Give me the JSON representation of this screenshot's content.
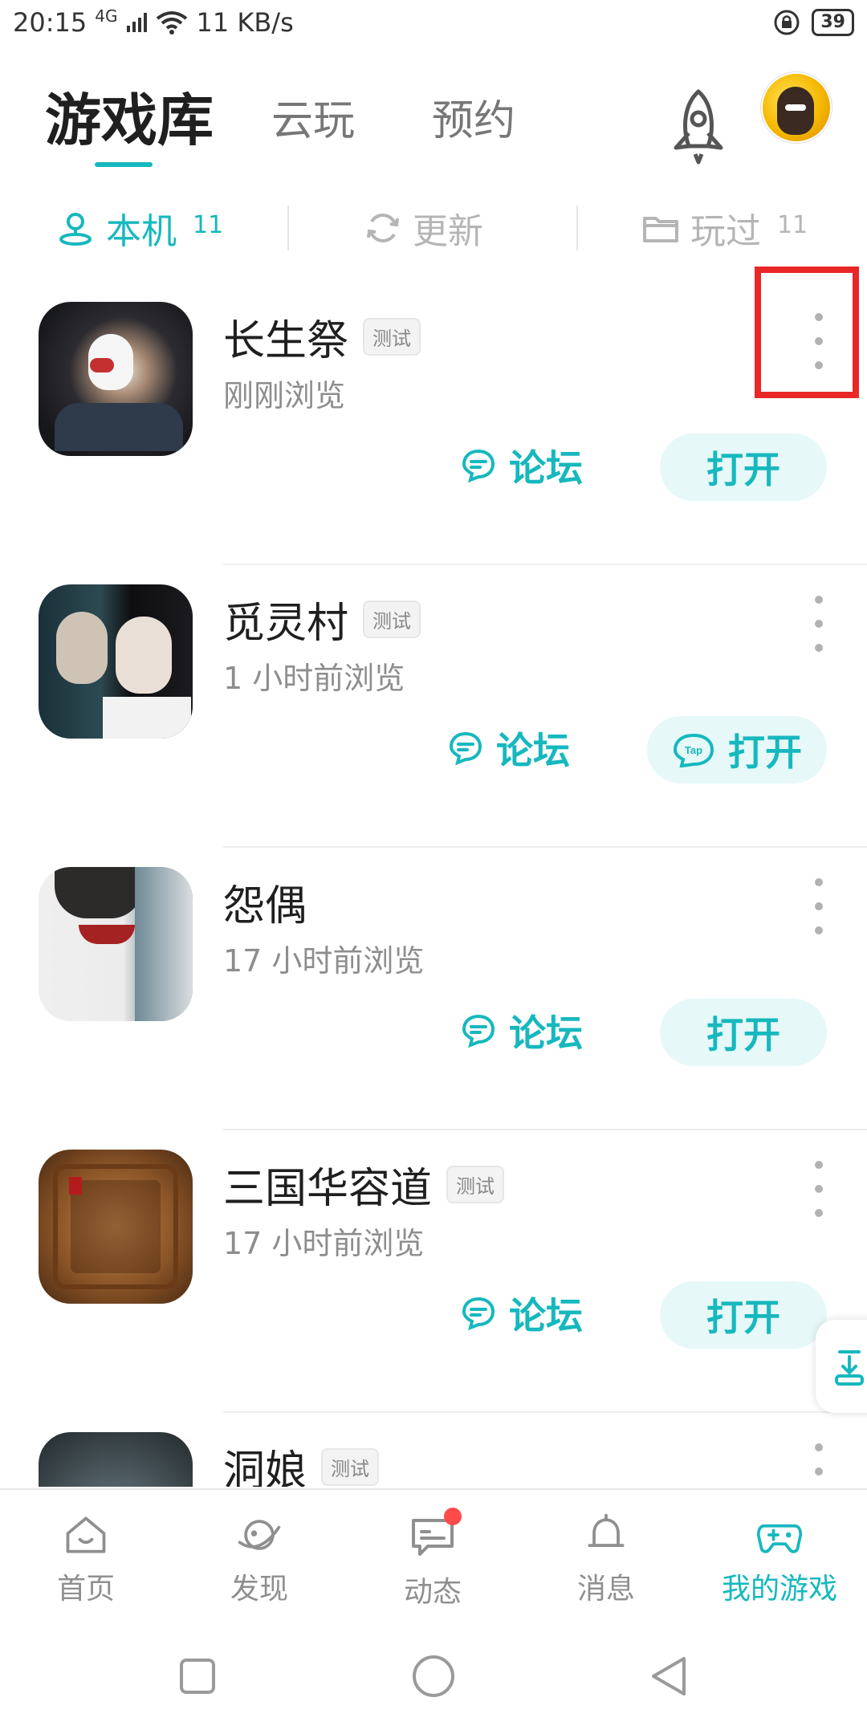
{
  "status_bar": {
    "time": "20:15",
    "network": "4G",
    "speed": "11 KB/s",
    "battery": "39"
  },
  "header": {
    "tabs": [
      {
        "label": "游戏库",
        "active": true
      },
      {
        "label": "云玩",
        "active": false
      },
      {
        "label": "预约",
        "active": false
      }
    ]
  },
  "subtabs": [
    {
      "label": "本机",
      "count": "11",
      "icon": "user-location-icon",
      "active": true
    },
    {
      "label": "更新",
      "count": "",
      "icon": "refresh-icon",
      "active": false
    },
    {
      "label": "玩过",
      "count": "11",
      "icon": "folder-icon",
      "active": false
    }
  ],
  "games": [
    {
      "title": "长生祭",
      "badge": "测试",
      "subtitle": "刚刚浏览",
      "forum": "论坛",
      "open": "打开",
      "open_has_tap_icon": false
    },
    {
      "title": "觅灵村",
      "badge": "测试",
      "subtitle": "1 小时前浏览",
      "forum": "论坛",
      "open": "打开",
      "open_has_tap_icon": true
    },
    {
      "title": "怨偶",
      "badge": "",
      "subtitle": "17 小时前浏览",
      "forum": "论坛",
      "open": "打开",
      "open_has_tap_icon": false
    },
    {
      "title": "三国华容道",
      "badge": "测试",
      "subtitle": "17 小时前浏览",
      "forum": "论坛",
      "open": "打开",
      "open_has_tap_icon": false
    },
    {
      "title": "洞娘",
      "badge": "测试",
      "subtitle": "",
      "forum": "",
      "open": "",
      "open_has_tap_icon": false
    }
  ],
  "bottom_nav": [
    {
      "label": "首页",
      "icon": "home-icon",
      "active": false
    },
    {
      "label": "发现",
      "icon": "discover-planet-icon",
      "active": false
    },
    {
      "label": "动态",
      "icon": "feed-chat-icon",
      "active": false,
      "has_dot": true
    },
    {
      "label": "消息",
      "icon": "bell-icon",
      "active": false
    },
    {
      "label": "我的游戏",
      "icon": "gamepad-icon",
      "active": true
    }
  ],
  "colors": {
    "accent": "#16b8be",
    "accent_bg": "#e6f8f8",
    "highlight": "#e82727",
    "notif": "#ff4a4a"
  }
}
